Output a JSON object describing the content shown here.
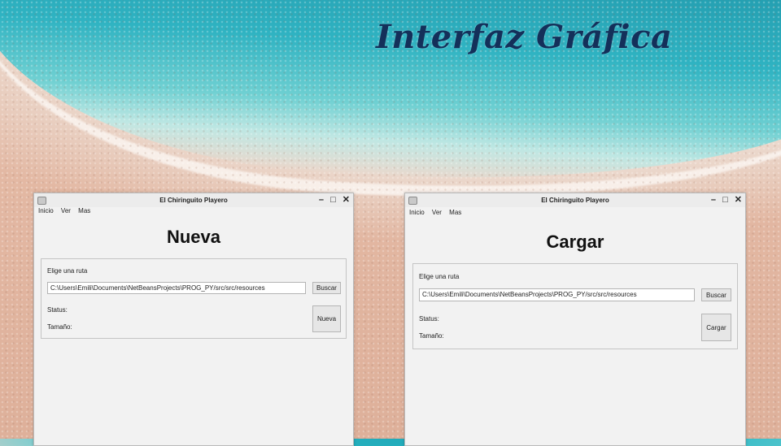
{
  "slide": {
    "title": "Interfaz Gráfica"
  },
  "windows": [
    {
      "title": "El Chiringuito Playero",
      "menu": [
        "Inicio",
        "Ver",
        "Mas"
      ],
      "heading": "Nueva",
      "route_label": "Elige una ruta",
      "path_value": "C:\\Users\\Emili\\Documents\\NetBeansProjects\\PROG_PY/src/src/resources",
      "search_button": "Buscar",
      "status_label": "Status:",
      "size_label": "Tamaño:",
      "action_button": "Nueva"
    },
    {
      "title": "El Chiringuito Playero",
      "menu": [
        "Inicio",
        "Ver",
        "Mas"
      ],
      "heading": "Cargar",
      "route_label": "Elige una ruta",
      "path_value": "C:\\Users\\Emili\\Documents\\NetBeansProjects\\PROG_PY/src/src/resources",
      "search_button": "Buscar",
      "status_label": "Status:",
      "size_label": "Tamaño:",
      "action_button": "Cargar"
    }
  ],
  "controls": {
    "minimize": "–",
    "maximize": "□",
    "close": "✕"
  }
}
